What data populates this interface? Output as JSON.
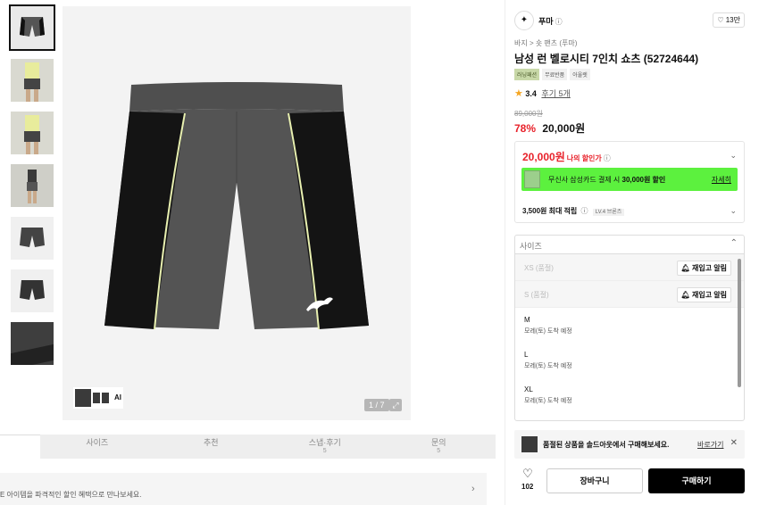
{
  "gallery": {
    "counter": "1 / 7",
    "ai_label": "AI",
    "thumbnails": [
      "product-front",
      "model-front-1",
      "model-front-2",
      "model-full",
      "product-detail-1",
      "product-detail-2",
      "fabric-closeup"
    ]
  },
  "tabs": [
    {
      "label": "사이즈",
      "sub": ""
    },
    {
      "label": "추천",
      "sub": ""
    },
    {
      "label": "스냅·후기",
      "sub": "5"
    },
    {
      "label": "문의",
      "sub": "5"
    }
  ],
  "promo_bar": {
    "text": "E 아이템을 파격적인 할인 혜택으로 만나보세요."
  },
  "brand": {
    "logo_glyph": "✦",
    "name": "푸마",
    "likes": "13만"
  },
  "breadcrumb": "바지 > 숏 팬츠 (푸마)",
  "product": {
    "title": "남성 런 벨로시티 7인치 쇼츠 (52724644)",
    "tags": [
      "러닝패션",
      "무료반품",
      "아울렛"
    ],
    "rating": "3.4",
    "reviews": "후기 5개",
    "original_price": "89,000원",
    "discount": "78%",
    "price": "20,000원"
  },
  "benefits": {
    "my_price": "20,000원",
    "my_price_label": "나의 할인가",
    "card_text_prefix": "무신사 삼성카드 결제 시 ",
    "card_text_bold": "30,000원 할인",
    "card_link": "자세히",
    "points": "3,500원 최대 적립",
    "level": "LV.4 브론즈"
  },
  "sizes": {
    "header": "사이즈",
    "restock_label": "재입고 알림",
    "soldout": [
      {
        "name": "XS (품절)"
      },
      {
        "name": "S (품절)"
      }
    ],
    "available": [
      {
        "name": "M",
        "eta": "모레(토) 도착 예정"
      },
      {
        "name": "L",
        "eta": "모레(토) 도착 예정"
      },
      {
        "name": "XL",
        "eta": "모레(토) 도착 예정"
      }
    ]
  },
  "notify": {
    "text": "품절된 상품을 솔드아웃에서 구매해보세요.",
    "link": "바로가기"
  },
  "actions": {
    "like_count": "102",
    "cart": "장바구니",
    "buy": "구매하기"
  },
  "colors": {
    "accent_red": "#e8222b",
    "card_banner": "#5cf13e",
    "buy_button": "#000000",
    "shorts_body": "#545454",
    "shorts_side": "#141414",
    "piping": "#e8f0b0"
  }
}
